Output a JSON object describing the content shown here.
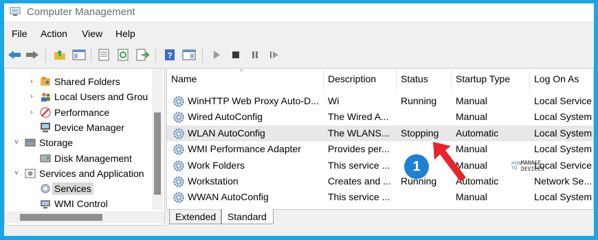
{
  "window": {
    "title": "Computer Management"
  },
  "menu": [
    "File",
    "Action",
    "View",
    "Help"
  ],
  "toolbar": {
    "icons": [
      "back-arrow-icon",
      "forward-arrow-icon",
      "up-folder-icon",
      "show-hide-tree-icon",
      "properties-icon",
      "refresh-icon",
      "export-list-icon",
      "help-icon",
      "show-hide-action-pane-icon",
      "start-service-icon",
      "stop-service-icon",
      "pause-service-icon",
      "restart-service-icon"
    ]
  },
  "tree": {
    "items": [
      {
        "label": "Shared Folders",
        "indent": 2,
        "chevron": "›",
        "icon": "shared-folders-icon"
      },
      {
        "label": "Local Users and Grou",
        "indent": 2,
        "chevron": "›",
        "icon": "local-users-icon"
      },
      {
        "label": "Performance",
        "indent": 2,
        "chevron": "›",
        "icon": "performance-icon"
      },
      {
        "label": "Device Manager",
        "indent": 2,
        "chevron": "",
        "icon": "device-manager-icon"
      },
      {
        "label": "Storage",
        "indent": 1,
        "chevron": "˅",
        "icon": "storage-icon"
      },
      {
        "label": "Disk Management",
        "indent": 2,
        "chevron": "",
        "icon": "disk-management-icon"
      },
      {
        "label": "Services and Application",
        "indent": 1,
        "chevron": "˅",
        "icon": "services-apps-icon"
      },
      {
        "label": "Services",
        "indent": 2,
        "chevron": "",
        "icon": "services-icon",
        "selected": true
      },
      {
        "label": "WMI Control",
        "indent": 2,
        "chevron": "",
        "icon": "wmi-control-icon"
      }
    ]
  },
  "list": {
    "columns": [
      "Name",
      "Description",
      "Status",
      "Startup Type",
      "Log On As"
    ],
    "rows": [
      {
        "name": "WinHTTP Web Proxy Auto-D...",
        "description": "Wi",
        "status": "Running",
        "startup": "Manual",
        "logon": "Local Service"
      },
      {
        "name": "Wired AutoConfig",
        "description": "The Wired A...",
        "status": "",
        "startup": "Manual",
        "logon": "Local System"
      },
      {
        "name": "WLAN AutoConfig",
        "description": "The WLANS...",
        "status": "Stopping",
        "startup": "Automatic",
        "logon": "Local System"
      },
      {
        "name": "WMI Performance Adapter",
        "description": "Provides per...",
        "status": "",
        "startup": "Manual",
        "logon": "Local System"
      },
      {
        "name": "Work Folders",
        "description": "This service ...",
        "status": "",
        "startup": "Manual",
        "logon": "Local Service"
      },
      {
        "name": "Workstation",
        "description": "Creates and ...",
        "status": "Running",
        "startup": "Automatic",
        "logon": "Network Se..."
      },
      {
        "name": "WWAN AutoConfig",
        "description": "This service ...",
        "status": "",
        "startup": "Manual",
        "logon": "Local System"
      }
    ]
  },
  "tabs": [
    {
      "label": "Extended",
      "active": false
    },
    {
      "label": "Standard",
      "active": true
    }
  ],
  "annotation": {
    "badge": "1",
    "color": "#1e7fd6",
    "arrow_color": "#e8232a"
  },
  "watermark": {
    "line1": "HOW",
    "line2": "TO",
    "line3": "MANAGE",
    "line4": "DEVICES"
  }
}
